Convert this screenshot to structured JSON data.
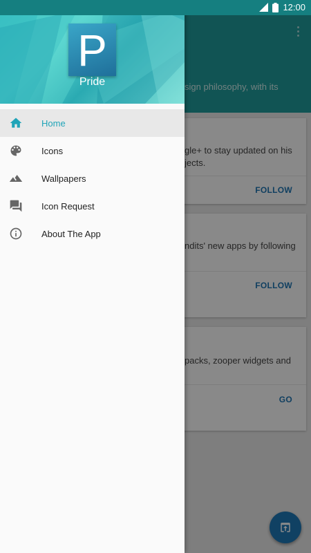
{
  "status_bar": {
    "time": "12:00"
  },
  "background": {
    "description_fragment": "sign philosophy, with its",
    "cards": [
      {
        "text_lines": [
          "gle+ to stay updated on his",
          "jects."
        ],
        "action": "FOLLOW"
      },
      {
        "text_lines": [
          "ndits' new apps by following"
        ],
        "action": "FOLLOW"
      },
      {
        "text_lines": [
          "packs, zooper widgets and"
        ],
        "action": "GO"
      }
    ]
  },
  "drawer": {
    "header": {
      "icon_letter": "P",
      "app_name": "Pride"
    },
    "items": [
      {
        "label": "Home",
        "icon": "home-icon",
        "active": true
      },
      {
        "label": "Icons",
        "icon": "palette-icon",
        "active": false
      },
      {
        "label": "Wallpapers",
        "icon": "landscape-icon",
        "active": false
      },
      {
        "label": "Icon Request",
        "icon": "chat-icon",
        "active": false
      },
      {
        "label": "About The App",
        "icon": "info-icon",
        "active": false
      }
    ]
  },
  "colors": {
    "toolbar": "#1f9a9a",
    "accent": "#20a4b8",
    "action_blue": "#1e73b0"
  }
}
